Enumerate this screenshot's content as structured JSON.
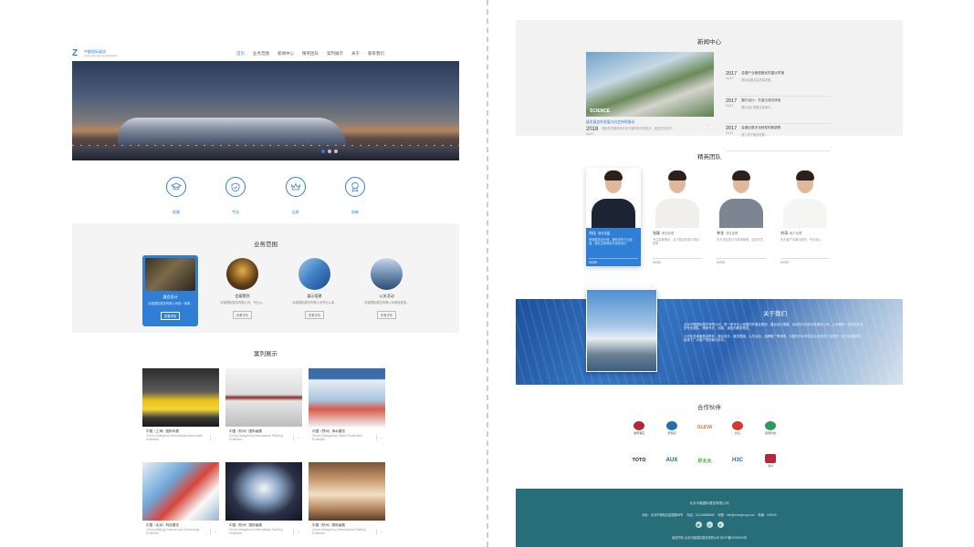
{
  "brand": {
    "logo_mark": "Z",
    "name": "中融国际展览",
    "tagline": "China Zhongrong Exhibition"
  },
  "nav": {
    "items": [
      {
        "label": "首页"
      },
      {
        "label": "业务范围"
      },
      {
        "label": "新闻中心"
      },
      {
        "label": "精英团队"
      },
      {
        "label": "案列展示"
      },
      {
        "label": "关于"
      },
      {
        "label": "联系我们"
      }
    ],
    "active_index": 0
  },
  "features": [
    {
      "icon": "graduation-cap-icon",
      "label": "权威"
    },
    {
      "icon": "shield-icon",
      "label": "专业"
    },
    {
      "icon": "crown-icon",
      "label": "品质"
    },
    {
      "icon": "award-icon",
      "label": "创新"
    }
  ],
  "services": {
    "title": "业务范围",
    "items": [
      {
        "title": "展会设计",
        "desc": "北城国际展览有限公司是一家集...",
        "more": "查看详情"
      },
      {
        "title": "会展策划",
        "desc": "北城国际展览有限公司，专业从...",
        "more": "查看详情"
      },
      {
        "title": "展示搭建",
        "desc": "北城国际展览有限公司专业从事...",
        "more": "查看详情"
      },
      {
        "title": "公关活动",
        "desc": "北城国际展览有限公司承接各类...",
        "more": "查看详情"
      }
    ]
  },
  "cases": {
    "title": "案列展示",
    "items": [
      {
        "cn": "中国（上海）国际车展",
        "en": "China (Shanghai) International Automobile Exhibition"
      },
      {
        "cn": "中国（杭州）国际画展",
        "en": "China (Hangzhou) International Painting Exhibition"
      },
      {
        "cn": "中国（郑州）净水展览",
        "en": "China (Zhengzhou) Water Purification Exhibition"
      },
      {
        "cn": "中国（北京）科技展览",
        "en": "China (Beijing) Science and Technology Exhibition"
      },
      {
        "cn": "中国（杭州）国际画展",
        "en": "China (Hangzhou) International Painting Exhibition"
      },
      {
        "cn": "中国（杭州）国际画展",
        "en": "China (Hangzhou) International Painting Exhibition"
      }
    ]
  },
  "news": {
    "title": "新闻中心",
    "image_label": "SCIENCE",
    "main": {
      "headline": "展览展会的发展方向会持续推动",
      "year": "2018",
      "date": "10-17",
      "summary": "展会的发展带动行业与城市的共同进步，促进交流合作..."
    },
    "list": [
      {
        "year": "2017",
        "date": "10-17",
        "title": "会展产业做强做优的重点举措",
        "summary": "推动会展业高质量发展..."
      },
      {
        "year": "2017",
        "date": "10-17",
        "title": "展厅设计：打造沉浸式体验",
        "summary": "展厅设计需要注重观众..."
      },
      {
        "year": "2017",
        "date": "10-17",
        "title": "会展业数字化转型的新趋势",
        "summary": "线上线下融合发展..."
      }
    ]
  },
  "team": {
    "title": "精英团队",
    "members": [
      {
        "name": "刘佳",
        "role": "设计总监",
        "desc": "资深展览设计师，拥有多年行业经验，擅长空间规划与创意设计",
        "more": "MORE"
      },
      {
        "name": "张颖",
        "role": "策划经理",
        "desc": "专注会展策划，善于整合资源与项目统筹",
        "more": "MORE"
      },
      {
        "name": "李龙",
        "role": "项目经理",
        "desc": "负责项目执行与现场管理，经验丰富",
        "more": "MORE"
      },
      {
        "name": "刘涛",
        "role": "客户经理",
        "desc": "负责客户沟通与服务，专业贴心",
        "more": "MORE"
      }
    ]
  },
  "about": {
    "title": "关于我们",
    "p1": "北京中融国际展览有限公司，是一家专业从事国内外展会策划、展台设计搭建、活动执行的综合性服务公司。公司拥有一支经验丰富的专业团队，秉承专业、创新、诚信的服务理念。",
    "p2": "公司业务涵盖展会策划、展台设计、展览搭建、公关活动、品牌推广等领域，为国内外众多知名企业提供了优质的一站式会展服务，赢得了广大客户的信赖与好评。"
  },
  "partners": {
    "title": "合作伙伴",
    "items": [
      {
        "name": "迪拜酒店",
        "mark_color": "#b0283a",
        "type": "mark"
      },
      {
        "name": "碧桂园",
        "mark_color": "#1f6fb2",
        "type": "mark"
      },
      {
        "name": "OLEVA",
        "mark_color": "#d4762a",
        "type": "word"
      },
      {
        "name": "长虹",
        "mark_color": "#d33a2f",
        "type": "mark"
      },
      {
        "name": "健康科技",
        "mark_color": "#2c9a5a",
        "type": "mark"
      },
      {
        "name": "TOTO",
        "mark_color": "#222222",
        "type": "word"
      },
      {
        "name": "AUX",
        "mark_color": "#1c4f9a",
        "type": "word"
      },
      {
        "name": "好太太",
        "mark_color": "#4b9a3a",
        "type": "word"
      },
      {
        "name": "H3C",
        "mark_color": "#1c6fb8",
        "type": "word"
      },
      {
        "name": "海尔",
        "mark_color": "#b0283a",
        "type": "mark"
      }
    ]
  },
  "footer": {
    "company": "北京中融国际展览有限公司",
    "address": "地址：北京市朝阳区建国路88号",
    "phone": "电话：010-88888888",
    "email": "邮箱：info@zhongrong.com",
    "zip": "邮编：100000",
    "copyright": "版权所有 北京中融国际展览有限公司 京ICP备00000000号"
  },
  "colors": {
    "accent": "#2f7fd6",
    "footer_bg": "#276e78",
    "section_bg": "#f4f4f4"
  }
}
